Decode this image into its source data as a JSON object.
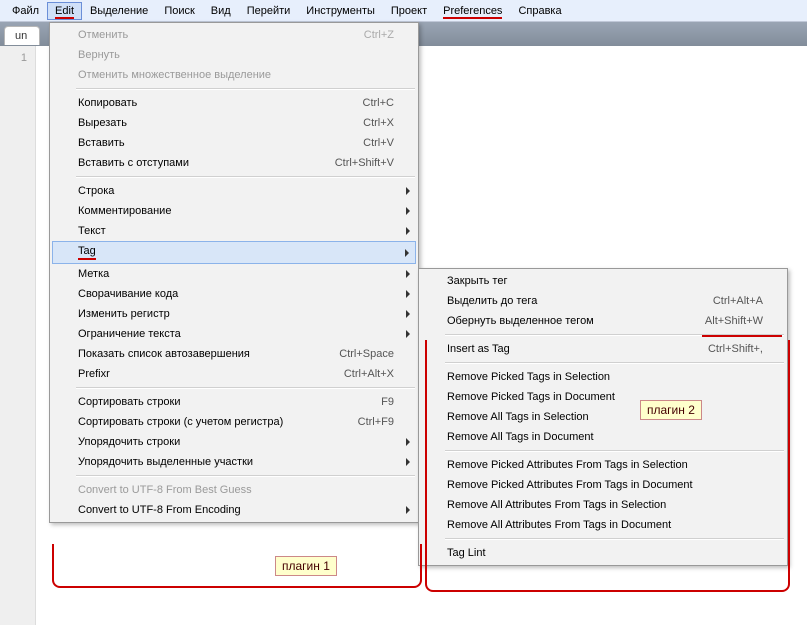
{
  "menubar": {
    "file": "Файл",
    "edit": "Edit",
    "selection": "Выделение",
    "find": "Поиск",
    "view": "Вид",
    "goto": "Перейти",
    "tools": "Инструменты",
    "project": "Проект",
    "preferences": "Preferences",
    "help": "Справка"
  },
  "tab": {
    "label": "un"
  },
  "gutter": {
    "line1": "1"
  },
  "edit_menu": {
    "undo": {
      "label": "Отменить",
      "shortcut": "Ctrl+Z"
    },
    "redo": {
      "label": "Вернуть"
    },
    "undo_multi": {
      "label": "Отменить множественное выделение"
    },
    "copy": {
      "label": "Копировать",
      "shortcut": "Ctrl+C"
    },
    "cut": {
      "label": "Вырезать",
      "shortcut": "Ctrl+X"
    },
    "paste": {
      "label": "Вставить",
      "shortcut": "Ctrl+V"
    },
    "paste_indent": {
      "label": "Вставить с отступами",
      "shortcut": "Ctrl+Shift+V"
    },
    "line": {
      "label": "Строка"
    },
    "comment": {
      "label": "Комментирование"
    },
    "text": {
      "label": "Текст"
    },
    "tag": {
      "label": "Tag"
    },
    "mark": {
      "label": "Метка"
    },
    "code_fold": {
      "label": "Сворачивание кода"
    },
    "case": {
      "label": "Изменить регистр"
    },
    "wrap": {
      "label": "Ограничение текста"
    },
    "autocomplete": {
      "label": "Показать список автозавершения",
      "shortcut": "Ctrl+Space"
    },
    "prefixr": {
      "label": "Prefixr",
      "shortcut": "Ctrl+Alt+X"
    },
    "sort": {
      "label": "Сортировать строки",
      "shortcut": "F9"
    },
    "sort_case": {
      "label": "Сортировать строки (с учетом регистра)",
      "shortcut": "Ctrl+F9"
    },
    "permute_lines": {
      "label": "Упорядочить строки"
    },
    "permute_sel": {
      "label": "Упорядочить выделенные участки"
    },
    "convert_guess": {
      "label": "Convert to UTF-8 From Best Guess"
    },
    "convert_enc": {
      "label": "Convert to UTF-8 From Encoding"
    }
  },
  "tag_menu": {
    "close_tag": {
      "label": "Закрыть тег"
    },
    "expand_sel": {
      "label": "Выделить до тега",
      "shortcut": "Ctrl+Alt+A"
    },
    "wrap_sel": {
      "label": "Обернуть выделенное тегом",
      "shortcut": "Alt+Shift+W"
    },
    "insert_tag": {
      "label": "Insert as Tag",
      "shortcut": "Ctrl+Shift+,"
    },
    "rm_picked_sel": {
      "label": "Remove Picked Tags in Selection"
    },
    "rm_picked_doc": {
      "label": "Remove Picked Tags in Document"
    },
    "rm_all_sel": {
      "label": "Remove All Tags in Selection"
    },
    "rm_all_doc": {
      "label": "Remove All Tags in Document"
    },
    "rm_attr_picked_sel": {
      "label": "Remove Picked Attributes From Tags in Selection"
    },
    "rm_attr_picked_doc": {
      "label": "Remove Picked Attributes From Tags in Document"
    },
    "rm_attr_all_sel": {
      "label": "Remove All Attributes From Tags in Selection"
    },
    "rm_attr_all_doc": {
      "label": "Remove All Attributes From Tags in Document"
    },
    "tag_lint": {
      "label": "Tag Lint"
    }
  },
  "annot": {
    "plugin1": "плагин 1",
    "plugin2": "плагин 2"
  }
}
